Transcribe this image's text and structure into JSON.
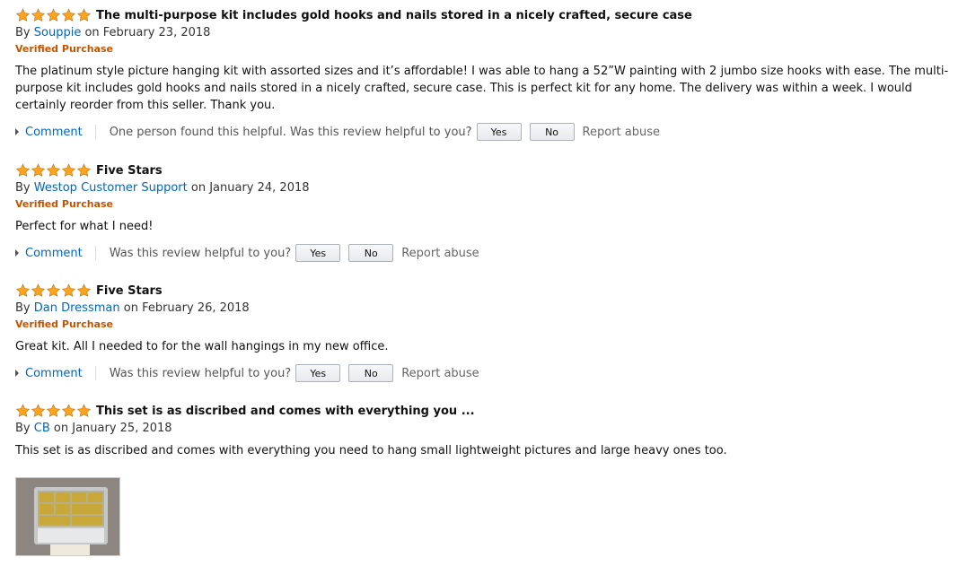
{
  "reviews": [
    {
      "rating": 5,
      "title": "The multi-purpose kit includes gold hooks and nails stored in a nicely crafted, secure case",
      "by_prefix": "By",
      "author": "Souppie",
      "date": "on February 23, 2018",
      "verified": "Verified Purchase",
      "body": "The platinum style picture hanging kit with assorted sizes and it’s affordable! I was able to hang a 52”W painting with 2 jumbo size hooks with ease. The multi-purpose kit includes gold hooks and nails stored in a nicely crafted, secure case. This is perfect kit for any home. The delivery was within a week. I would certainly reorder from this seller. Thank you.",
      "comment_label": "Comment",
      "helpful_text": "One person found this helpful. Was this review helpful to you?",
      "yes_label": "Yes",
      "no_label": "No",
      "report_label": "Report abuse"
    },
    {
      "rating": 5,
      "title": "Five Stars",
      "by_prefix": "By",
      "author": "Westop Customer Support",
      "date": "on January 24, 2018",
      "verified": "Verified Purchase",
      "body": "Perfect for what I need!",
      "comment_label": "Comment",
      "helpful_text": "Was this review helpful to you?",
      "yes_label": "Yes",
      "no_label": "No",
      "report_label": "Report abuse"
    },
    {
      "rating": 5,
      "title": "Five Stars",
      "by_prefix": "By",
      "author": "Dan Dressman",
      "date": "on February 26, 2018",
      "verified": "Verified Purchase",
      "body": "Great kit. All I needed to for the wall hangings in my new office.",
      "comment_label": "Comment",
      "helpful_text": "Was this review helpful to you?",
      "yes_label": "Yes",
      "no_label": "No",
      "report_label": "Report abuse"
    },
    {
      "rating": 5,
      "title": "This set is as discribed and comes with everything you ...",
      "by_prefix": "By",
      "author": "CB",
      "date": "on January 25, 2018",
      "body": "This set is as discribed and comes with everything you need to hang small lightweight pictures and large heavy ones too."
    }
  ],
  "colors": {
    "star": "#ffa41c",
    "link": "#0066c0",
    "verified": "#c45500"
  },
  "icons": {
    "star": "star-icon",
    "caret": "caret-right-icon"
  }
}
